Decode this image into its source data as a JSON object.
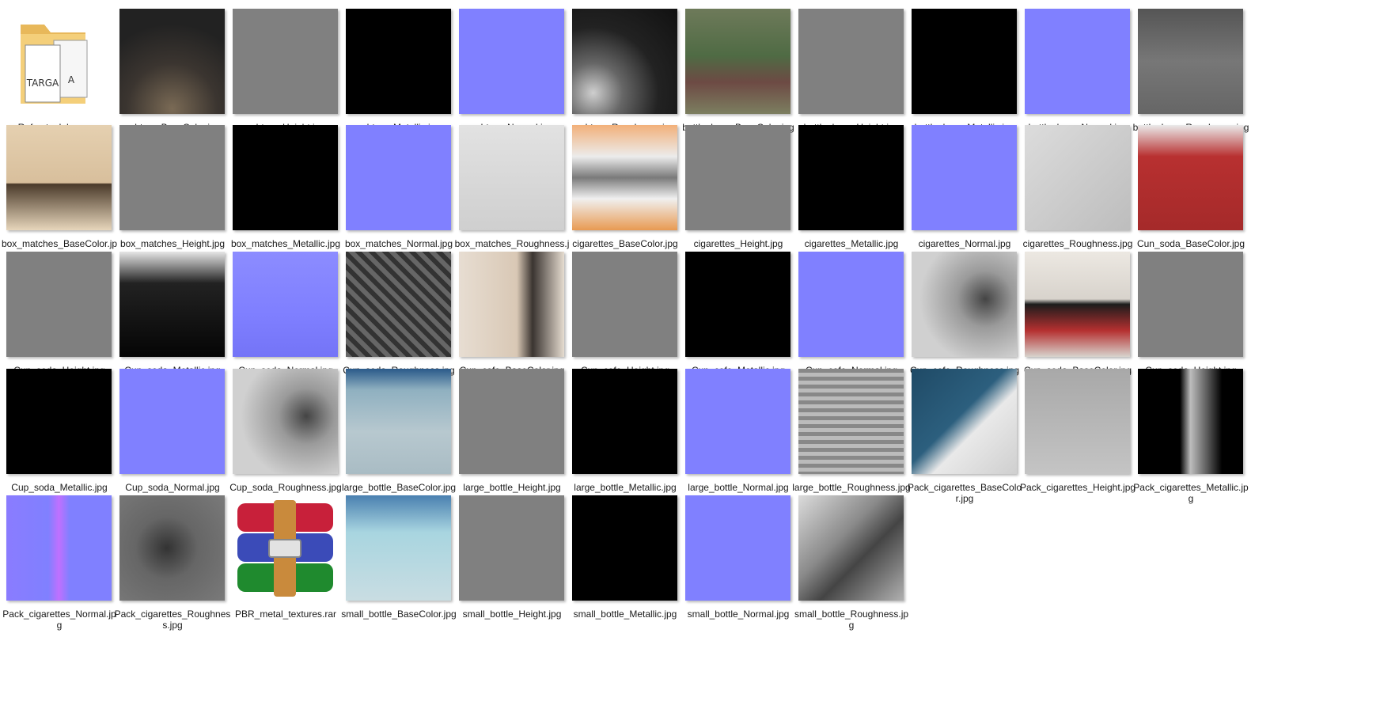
{
  "items": [
    {
      "label": "Refract_alpha_map",
      "thumb": "folder",
      "icon": "folder-icon"
    },
    {
      "label": "ashtray_BaseColor.jpg",
      "thumb": "ashcolor"
    },
    {
      "label": "ashtray_Height.jpg",
      "thumb": "gray"
    },
    {
      "label": "ashtray_Metallic.jpg",
      "thumb": "dark"
    },
    {
      "label": "ashtray_Normal.jpg",
      "thumb": "normal"
    },
    {
      "label": "ashtray_Roughness.jpg",
      "thumb": "ashrough"
    },
    {
      "label": "bottle_beer_BaseColor.jpg",
      "thumb": "beercolor"
    },
    {
      "label": "bottle_beer_Height.jpg",
      "thumb": "gray"
    },
    {
      "label": "bottle_beer_Metallic.jpg",
      "thumb": "dark"
    },
    {
      "label": "bottle_beer_Normal.jpg",
      "thumb": "normal"
    },
    {
      "label": "bottle_beer_Roughness.jpg",
      "thumb": "beerrough"
    },
    {
      "label": "box_matches_BaseColor.jpg",
      "thumb": "matchcolor"
    },
    {
      "label": "box_matches_Height.jpg",
      "thumb": "gray"
    },
    {
      "label": "box_matches_Metallic.jpg",
      "thumb": "dark"
    },
    {
      "label": "box_matches_Normal.jpg",
      "thumb": "normal"
    },
    {
      "label": "box_matches_Roughness.jpg",
      "thumb": "matchrough"
    },
    {
      "label": "cigarettes_BaseColor.jpg",
      "thumb": "cigcolor"
    },
    {
      "label": "cigarettes_Height.jpg",
      "thumb": "gray"
    },
    {
      "label": "cigarettes_Metallic.jpg",
      "thumb": "dark"
    },
    {
      "label": "cigarettes_Normal.jpg",
      "thumb": "normal"
    },
    {
      "label": "cigarettes_Roughness.jpg",
      "thumb": "light"
    },
    {
      "label": "Cun_soda_BaseColor.jpg",
      "thumb": "sodacolor"
    },
    {
      "label": "Cun_soda_Height.jpg",
      "thumb": "gray"
    },
    {
      "label": "Cun_soda_Metallic.jpg",
      "thumb": "sodamet"
    },
    {
      "label": "Cun_soda_Normal.jpg",
      "thumb": "normal2"
    },
    {
      "label": "Cun_soda_Roughness.jpg",
      "thumb": "sodarough"
    },
    {
      "label": "Cup_cofe_BaseColor.jpg",
      "thumb": "cupcofe"
    },
    {
      "label": "Cup_cofe_Height.jpg",
      "thumb": "gray"
    },
    {
      "label": "Cup_cofe_Metallic.jpg",
      "thumb": "dark"
    },
    {
      "label": "Cup_cofe_Normal.jpg",
      "thumb": "normal"
    },
    {
      "label": "Cup_cofe_Roughness.jpg",
      "thumb": "cuprough"
    },
    {
      "label": "Cup_soda_BaseColor.jpg",
      "thumb": "cupsodacolor"
    },
    {
      "label": "Cup_soda_Height.jpg",
      "thumb": "gray"
    },
    {
      "label": "Cup_soda_Metallic.jpg",
      "thumb": "dark"
    },
    {
      "label": "Cup_soda_Normal.jpg",
      "thumb": "normal"
    },
    {
      "label": "Cup_soda_Roughness.jpg",
      "thumb": "cuprough"
    },
    {
      "label": "large_bottle_BaseColor.jpg",
      "thumb": "bigbottle"
    },
    {
      "label": "large_bottle_Height.jpg",
      "thumb": "gray"
    },
    {
      "label": "large_bottle_Metallic.jpg",
      "thumb": "dark"
    },
    {
      "label": "large_bottle_Normal.jpg",
      "thumb": "normal"
    },
    {
      "label": "large_bottle_Roughness.jpg",
      "thumb": "bigrough"
    },
    {
      "label": "Pack_cigarettes_BaseColor.jpg",
      "thumb": "packcolor"
    },
    {
      "label": "Pack_cigarettes_Height.jpg",
      "thumb": "packheight"
    },
    {
      "label": "Pack_cigarettes_Metallic.jpg",
      "thumb": "packmet"
    },
    {
      "label": "Pack_cigarettes_Normal.jpg",
      "thumb": "packnormal"
    },
    {
      "label": "Pack_cigarettes_Roughness.jpg",
      "thumb": "packrough"
    },
    {
      "label": "PBR_metal_textures.rar",
      "thumb": "rar",
      "icon": "winrar-archive-icon"
    },
    {
      "label": "small_bottle_BaseColor.jpg",
      "thumb": "smallcolor"
    },
    {
      "label": "small_bottle_Height.jpg",
      "thumb": "gray"
    },
    {
      "label": "small_bottle_Metallic.jpg",
      "thumb": "dark"
    },
    {
      "label": "small_bottle_Normal.jpg",
      "thumb": "normal"
    },
    {
      "label": "small_bottle_Roughness.jpg",
      "thumb": "smallrough"
    }
  ],
  "icons": {
    "folder_badge_top": "TARGA",
    "folder_badge_side": "A"
  }
}
